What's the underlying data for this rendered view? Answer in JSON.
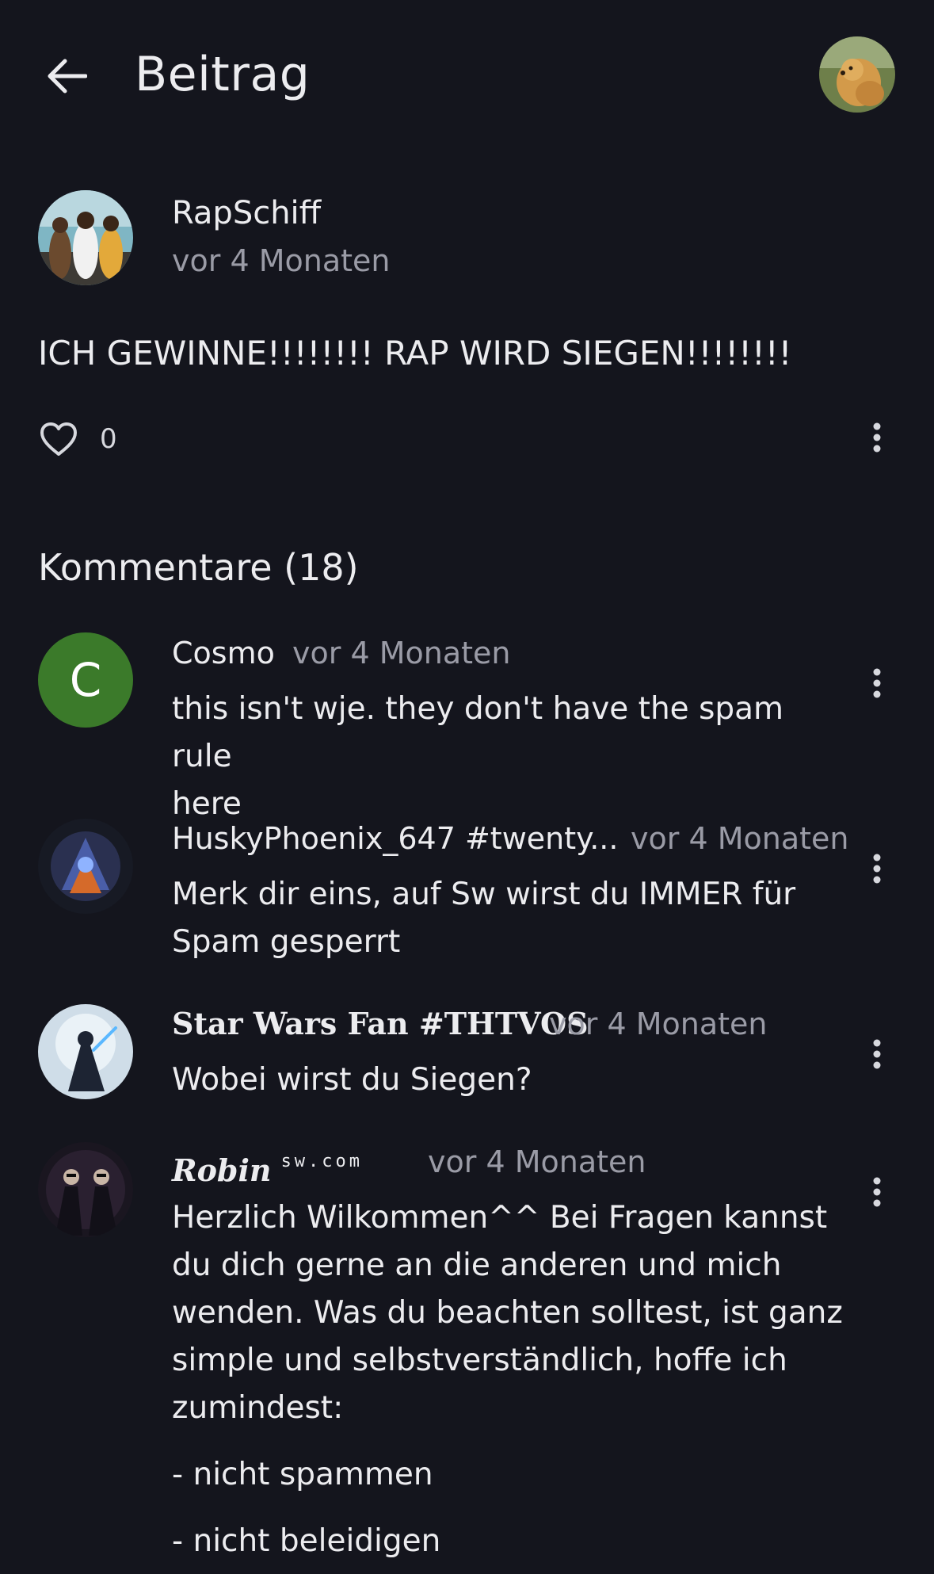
{
  "header": {
    "title": "Beitrag",
    "back_icon": "arrow-left-icon",
    "avatar_icon": "profile-avatar-dog"
  },
  "post": {
    "author": "RapSchiff",
    "time": "vor 4 Monaten",
    "body": "ICH GEWINNE!!!!!!!! RAP WIRD SIEGEN!!!!!!!!",
    "likes": "0",
    "like_icon": "heart-outline-icon",
    "more_icon": "more-vertical-icon"
  },
  "comments_section": {
    "title": "Kommentare (18)",
    "comments": [
      {
        "author": "Cosmo",
        "avatar_letter": "C",
        "time": "vor 4 Monaten",
        "text_lines": [
          "this isn't wje. they don't have the spam rule",
          "here"
        ]
      },
      {
        "author": "HuskyPhoenix_647 #twenty...",
        "time": "vor 4 Monaten",
        "text_lines": [
          "Merk dir eins, auf Sw wirst du IMMER für",
          "Spam gesperrt"
        ]
      },
      {
        "author": "Star Wars Fan #THTVOS",
        "time": "vor 4 Monaten",
        "text_lines": [
          "Wobei wirst du Siegen?"
        ]
      },
      {
        "author": "Robin",
        "author_suffix": "sw.com",
        "time": "vor 4 Monaten",
        "text_lines": [
          "Herzlich Wilkommen^^ Bei Fragen kannst",
          "du dich gerne an die anderen und mich",
          "wenden. Was du beachten solltest, ist ganz",
          "simple und selbstverständlich, hoffe ich",
          "zumindest:"
        ],
        "list_items": [
          "- nicht spammen",
          "- nicht beleidigen"
        ]
      }
    ]
  },
  "colors": {
    "background": "#14151d",
    "text_primary": "#ececef",
    "text_secondary": "#9a9ba6",
    "cosmo_avatar": "#3b7a2a"
  }
}
